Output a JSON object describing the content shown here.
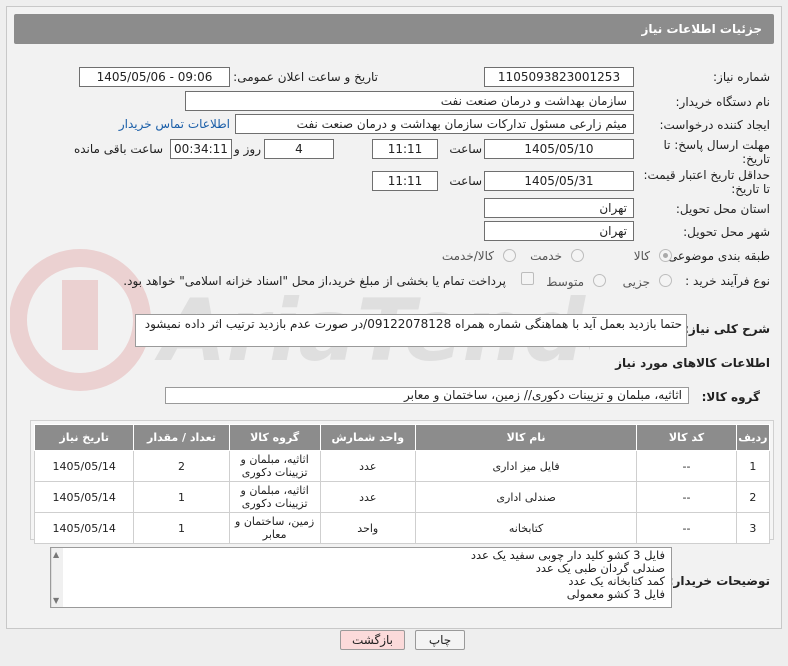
{
  "header": {
    "title": "جزئیات اطلاعات نیاز"
  },
  "fields": {
    "need_number_label": "شماره نیاز:",
    "need_number": "1105093823001253",
    "announce_label": "تاریخ و ساعت اعلان عمومی:",
    "announce_value": "1405/05/06 - 09:06",
    "buyer_org_label": "نام دستگاه خریدار:",
    "buyer_org": "سازمان بهداشت و درمان صنعت نفت",
    "creator_label": "ایجاد کننده درخواست:",
    "creator": "میثم زارعی مسئول تدارکات سازمان بهداشت و درمان صنعت نفت",
    "contact_link": "اطلاعات تماس خریدار",
    "reply_deadline_label_1": "مهلت ارسال پاسخ: تا",
    "reply_deadline_label_2": "تاریخ:",
    "reply_date": "1405/05/10",
    "time_label": "ساعت",
    "reply_time": "11:11",
    "days_value": "4",
    "days_label": "روز و",
    "remaining_time": "00:34:11",
    "remaining_label": "ساعت باقی مانده",
    "price_validity_label_1": "حداقل تاریخ اعتبار قیمت:",
    "price_validity_label_2": "تا تاریخ:",
    "price_date": "1405/05/31",
    "price_time": "11:11",
    "province_label": "استان محل تحویل:",
    "province": "تهران",
    "city_label": "شهر محل تحویل:",
    "city": "تهران",
    "category_label": "طبقه بندی موضوعی:",
    "category_options": [
      "کالا",
      "خدمت",
      "کالا/خدمت"
    ],
    "process_label": "نوع فرآیند خرید :",
    "process_options": [
      "جزیی",
      "متوسط"
    ],
    "payment_note": "پرداخت تمام یا بخشی از مبلغ خرید،از محل \"اسناد خزانه اسلامی\" خواهد بود."
  },
  "description": {
    "label": "شرح کلی نیاز:",
    "text": "حتما بازدید بعمل آید با هماهنگی شماره همراه 09122078128/در صورت عدم بازدید ترتیب اثر داده نمیشود"
  },
  "goods_info": {
    "section_title": "اطلاعات کالاهای مورد نیاز",
    "group_label": "گروه کالا:",
    "group_value": "اثاثیه، مبلمان و تزیینات دکوری// زمین، ساختمان و معابر"
  },
  "table": {
    "headers": [
      "ردیف",
      "کد کالا",
      "نام کالا",
      "واحد شمارش",
      "گروه کالا",
      "تعداد / مقدار",
      "تاریخ نیاز"
    ],
    "rows": [
      [
        "1",
        "--",
        "فایل میز اداری",
        "عدد",
        "اثاثیه، مبلمان و تزیینات دکوری",
        "2",
        "1405/05/14"
      ],
      [
        "2",
        "--",
        "صندلی اداری",
        "عدد",
        "اثاثیه، مبلمان و تزیینات دکوری",
        "1",
        "1405/05/14"
      ],
      [
        "3",
        "--",
        "کتابخانه",
        "واحد",
        "زمین، ساختمان و معابر",
        "1",
        "1405/05/14"
      ]
    ]
  },
  "buyer_notes": {
    "label": "توضیحات خریدار:",
    "lines": [
      "فایل 3 کشو کلید دار چوبی سفید  یک عدد",
      "صندلی گردان طبی یک عدد",
      "کمد کتابخانه  یک عدد",
      "فایل 3 کشو معمولی"
    ]
  },
  "buttons": {
    "print": "چاپ",
    "back": "بازگشت"
  },
  "colors": {
    "header_bg": "#8c8c8c",
    "link": "#1a5ea8",
    "back_button_bg": "#fbdada"
  }
}
